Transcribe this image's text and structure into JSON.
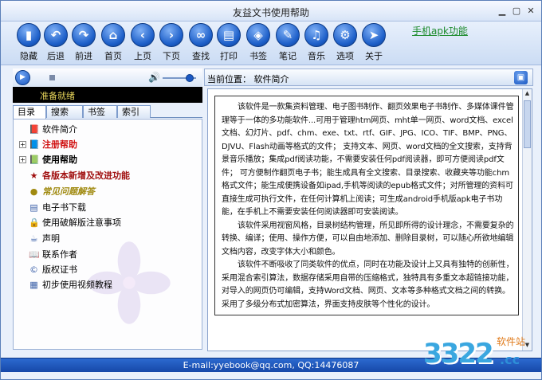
{
  "window": {
    "title": "友益文书使用帮助"
  },
  "toolbar": {
    "buttons": [
      {
        "label": "隐藏",
        "icon": "hide-icon",
        "glyph": "▮"
      },
      {
        "label": "后退",
        "icon": "back-icon",
        "glyph": "↶"
      },
      {
        "label": "前进",
        "icon": "forward-icon",
        "glyph": "↷"
      },
      {
        "label": "首页",
        "icon": "home-icon",
        "glyph": "⌂"
      },
      {
        "label": "上页",
        "icon": "prev-page-icon",
        "glyph": "‹"
      },
      {
        "label": "下页",
        "icon": "next-page-icon",
        "glyph": "›"
      },
      {
        "label": "查找",
        "icon": "binoculars-icon",
        "glyph": "∞"
      },
      {
        "label": "打印",
        "icon": "printer-icon",
        "glyph": "▤"
      },
      {
        "label": "书签",
        "icon": "bookmark-icon",
        "glyph": "◈"
      },
      {
        "label": "笔记",
        "icon": "notes-icon",
        "glyph": "✎"
      },
      {
        "label": "音乐",
        "icon": "music-icon",
        "glyph": "♫"
      },
      {
        "label": "选项",
        "icon": "gear-icon",
        "glyph": "⚙"
      },
      {
        "label": "关于",
        "icon": "cursor-icon",
        "glyph": "➤"
      }
    ],
    "link": "手机apk功能"
  },
  "player": {
    "status": "准备就绪"
  },
  "tabs": [
    "目录",
    "搜索",
    "书签",
    "索引"
  ],
  "tree": [
    {
      "label": "软件简介",
      "icon": "book-icon",
      "glyph": "📕",
      "color": "#000000",
      "bold": false,
      "italic": false,
      "expander": ""
    },
    {
      "label": "注册帮助",
      "icon": "install-icon",
      "glyph": "📘",
      "color": "#d01010",
      "bold": true,
      "italic": false,
      "expander": "+"
    },
    {
      "label": "使用帮助",
      "icon": "book-icon",
      "glyph": "📗",
      "color": "#000000",
      "bold": true,
      "italic": false,
      "expander": "+"
    },
    {
      "label": "各版本新增及改进功能",
      "icon": "star-icon",
      "glyph": "★",
      "color": "#a01010",
      "bold": true,
      "italic": false,
      "expander": ""
    },
    {
      "label": "常见问题解答",
      "icon": "help-icon",
      "glyph": "●",
      "color": "#a08a10",
      "bold": true,
      "italic": true,
      "expander": ""
    },
    {
      "label": "电子书下载",
      "icon": "download-icon",
      "glyph": "▤",
      "color": "#000000",
      "bold": false,
      "italic": false,
      "expander": ""
    },
    {
      "label": "使用破解版注意事项",
      "icon": "lock-icon",
      "glyph": "🔒",
      "color": "#000000",
      "bold": false,
      "italic": false,
      "expander": ""
    },
    {
      "label": "声明",
      "icon": "cup-icon",
      "glyph": "☕",
      "color": "#000000",
      "bold": false,
      "italic": false,
      "expander": ""
    },
    {
      "label": "联系作者",
      "icon": "book-open-icon",
      "glyph": "📖",
      "color": "#000000",
      "bold": false,
      "italic": false,
      "expander": ""
    },
    {
      "label": "版权证书",
      "icon": "certificate-icon",
      "glyph": "©",
      "color": "#000000",
      "bold": false,
      "italic": false,
      "expander": ""
    },
    {
      "label": "初步使用视频教程",
      "icon": "video-icon",
      "glyph": "▦",
      "color": "#000000",
      "bold": false,
      "italic": false,
      "expander": ""
    }
  ],
  "pathbar": {
    "label": "当前位置：  软件简介"
  },
  "content": {
    "paragraphs": [
      "该软件是一款集资料管理、电子图书制作、翻页效果电子书制作、多媒体课件管理等于一体的多功能软件...可用于管理htm网页、mht单一网页、word文档、excel文档、幻灯片、pdf、chm、exe、txt、rtf、GIF、JPG、ICO、TIF、BMP、PNG、DJVU、Flash动画等格式的文件；  支持文本、网页、word文档的全文搜索，支持背景音乐播放；集成pdf阅读功能，不需要安装任何pdf阅读器，即可方便阅读pdf文件；  可方便制作翻页电子书；能生成具有全文搜索、目录搜索、收藏夹等功能chm格式文件；能生成便携设备如ipad,手机等阅读的epub格式文件；对所管理的资料可直接生成可执行文件，在任何计算机上阅读；可生成android手机版apk电子书功能，在手机上不需要安装任何阅读器即可安装阅读。",
      "该软件采用视窗风格，目录树结构管理，所见即所得的设计理念，不需要复杂的转换、编译；使用、操作方便，可以自由地添加、删除目录树，可以随心所欲地编辑文档内容，改变字体大小和颜色。",
      "该软件不断吸收了同类软件的优点，同时在功能及设计上又具有独特的创新性，采用混合索引算法，数据存储采用自带的压缩格式，独特具有多重文本超链接功能，对导入的网页仍可编辑，支持Word文档、网页、文本等多种格式文档之间的转换。采用了多级分布式加密算法，界面支持皮肤等个性化的设计。"
    ]
  },
  "statusbar": {
    "text": "E-mail:yyebook@qq.com,   QQ:14476087"
  },
  "watermark": {
    "num": "3322",
    "site": "软件站",
    "domain": ".cc"
  }
}
